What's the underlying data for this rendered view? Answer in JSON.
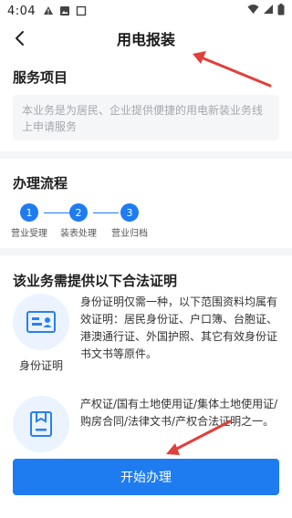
{
  "status_bar": {
    "time": "4:04",
    "left_icons": [
      "alert-icon",
      "image-icon",
      "square-icon"
    ],
    "right_icons": [
      "wifi-icon",
      "signal-icon",
      "battery-icon"
    ]
  },
  "nav": {
    "title": "用电报装",
    "back_icon": "chevron-left-icon"
  },
  "service": {
    "title": "服务项目",
    "description": "本业务是为居民、企业提供便捷的用电新装业务线上申请服务"
  },
  "process": {
    "title": "办理流程",
    "steps": [
      {
        "number": "1",
        "label": "营业受理"
      },
      {
        "number": "2",
        "label": "装表处理"
      },
      {
        "number": "3",
        "label": "营业归档"
      }
    ],
    "accent": "#1e7cf0"
  },
  "documents": {
    "title": "该业务需提供以下合法证明",
    "items": [
      {
        "icon": "id-card-icon",
        "caption": "身份证明",
        "text": "身份证明仅需一种，以下范围资料均属有效证明：居民身份证、户口簿、台胞证、港澳通行证、外国护照、其它有效身份证书文书等原件。"
      },
      {
        "icon": "document-icon",
        "caption": "",
        "text": "产权证/国有土地使用证/集体土地使用证/购房合同/法律文书/产权合法证明之一。"
      }
    ]
  },
  "footer": {
    "start_label": "开始办理"
  },
  "colors": {
    "primary": "#1e7cf0",
    "section_bg": "#f4f5f7",
    "annotation": "#e0403a"
  }
}
